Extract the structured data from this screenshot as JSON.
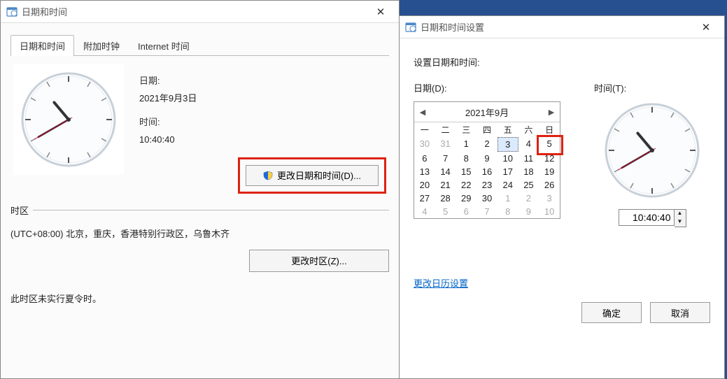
{
  "win1": {
    "title": "日期和时间",
    "tabs": [
      "日期和时间",
      "附加时钟",
      "Internet 时间"
    ],
    "date_label": "日期:",
    "date_value": "2021年9月3日",
    "time_label": "时间:",
    "time_value": "10:40:40",
    "change_datetime_btn": "更改日期和时间(D)...",
    "tz_header": "时区",
    "tz_value": "(UTC+08:00) 北京，重庆，香港特别行政区，乌鲁木齐",
    "change_tz_btn": "更改时区(Z)...",
    "dst_note": "此时区未实行夏令时。"
  },
  "win2": {
    "title": "日期和时间设置",
    "heading": "设置日期和时间:",
    "date_label": "日期(D):",
    "time_label": "时间(T):",
    "cal_title": "2021年9月",
    "dow": [
      "一",
      "二",
      "三",
      "四",
      "五",
      "六",
      "日"
    ],
    "calendar": [
      [
        {
          "d": 30,
          "o": 1
        },
        {
          "d": 31,
          "o": 1
        },
        {
          "d": 1
        },
        {
          "d": 2
        },
        {
          "d": 3,
          "sel": 1
        },
        {
          "d": 4
        },
        {
          "d": 5,
          "mark": 1
        }
      ],
      [
        {
          "d": 6
        },
        {
          "d": 7
        },
        {
          "d": 8
        },
        {
          "d": 9
        },
        {
          "d": 10
        },
        {
          "d": 11
        },
        {
          "d": 12
        }
      ],
      [
        {
          "d": 13
        },
        {
          "d": 14
        },
        {
          "d": 15
        },
        {
          "d": 16
        },
        {
          "d": 17
        },
        {
          "d": 18
        },
        {
          "d": 19
        }
      ],
      [
        {
          "d": 20
        },
        {
          "d": 21
        },
        {
          "d": 22
        },
        {
          "d": 23
        },
        {
          "d": 24
        },
        {
          "d": 25
        },
        {
          "d": 26
        }
      ],
      [
        {
          "d": 27
        },
        {
          "d": 28
        },
        {
          "d": 29
        },
        {
          "d": 30
        },
        {
          "d": 1,
          "o": 1
        },
        {
          "d": 2,
          "o": 1
        },
        {
          "d": 3,
          "o": 1
        }
      ],
      [
        {
          "d": 4,
          "o": 1
        },
        {
          "d": 5,
          "o": 1
        },
        {
          "d": 6,
          "o": 1
        },
        {
          "d": 7,
          "o": 1
        },
        {
          "d": 8,
          "o": 1
        },
        {
          "d": 9,
          "o": 1
        },
        {
          "d": 10,
          "o": 1
        }
      ]
    ],
    "time_value": "10:40:40",
    "cal_settings_link": "更改日历设置",
    "ok_btn": "确定",
    "cancel_btn": "取消"
  },
  "clock": {
    "hour_angle": 320,
    "minute_angle": 240,
    "second_angle": 240
  }
}
